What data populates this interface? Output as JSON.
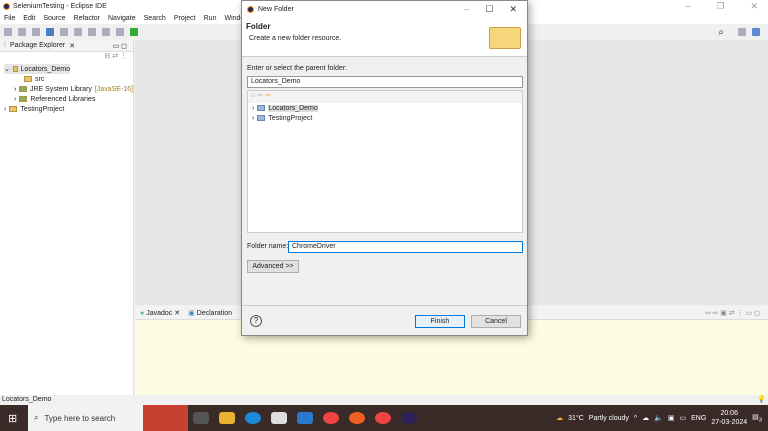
{
  "window": {
    "title": "SeleniumTesting - Eclipse IDE"
  },
  "menu": [
    "File",
    "Edit",
    "Source",
    "Refactor",
    "Navigate",
    "Search",
    "Project",
    "Run",
    "Window"
  ],
  "package_explorer": {
    "title": "Package Explorer",
    "items": [
      {
        "label": "Locators_Demo",
        "level": 0
      },
      {
        "label": "src",
        "level": 1
      },
      {
        "label": "JRE System Library",
        "suffix": "[JavaSE-16]",
        "level": 1
      },
      {
        "label": "Referenced Libraries",
        "level": 1
      },
      {
        "label": "TestingProject",
        "level": 0
      }
    ]
  },
  "bottom_tabs": [
    "Javadoc",
    "Declaration"
  ],
  "status_bar": "Locators_Demo",
  "dialog": {
    "title": "New Folder",
    "heading": "Folder",
    "description": "Create a new folder resource.",
    "parent_label": "Enter or select the parent folder:",
    "parent_value": "Locators_Demo",
    "tree": [
      "Locators_Demo",
      "TestingProject"
    ],
    "folder_name_label": "Folder name:",
    "folder_name_value": "ChromeDriver",
    "advanced": "Advanced >>",
    "finish": "Finish",
    "cancel": "Cancel"
  },
  "taskbar": {
    "search_placeholder": "Type here to search",
    "weather": "31°C",
    "weather_desc": "Partly cloudy",
    "lang": "ENG",
    "time": "20:06",
    "date": "27-03-2024",
    "notifications": "3"
  }
}
